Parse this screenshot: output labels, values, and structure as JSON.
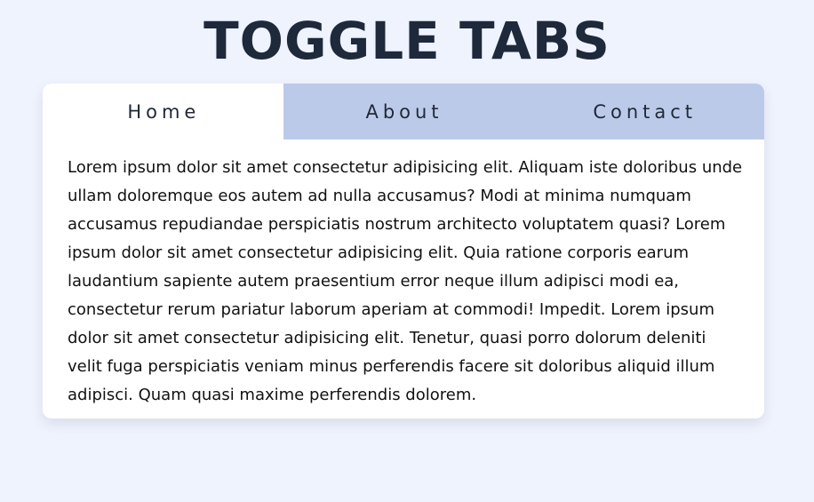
{
  "header": {
    "title": "TOGGLE TABS"
  },
  "tabs": [
    {
      "label": "Home",
      "active": true
    },
    {
      "label": "About",
      "active": false
    },
    {
      "label": "Contact",
      "active": false
    }
  ],
  "panel": {
    "text": "Lorem ipsum dolor sit amet consectetur adipisicing elit. Aliquam iste doloribus unde ullam doloremque eos autem ad nulla accusamus? Modi at minima numquam accusamus repudiandae perspiciatis nostrum architecto voluptatem quasi? Lorem ipsum dolor sit amet consectetur adipisicing elit. Quia ratione corporis earum laudantium sapiente autem praesentium error neque illum adipisci modi ea, consectetur rerum pariatur laborum aperiam at commodi! Impedit. Lorem ipsum dolor sit amet consectetur adipisicing elit. Tenetur, quasi porro dolorum deleniti velit fuga perspiciatis veniam minus perferendis facere sit doloribus aliquid illum adipisci. Quam quasi maxime perferendis dolorem."
  },
  "colors": {
    "page_background": "#eff3fe",
    "title": "#1e293b",
    "tab_bar": "#bccaea",
    "active_tab": "#ffffff",
    "card": "#ffffff"
  }
}
